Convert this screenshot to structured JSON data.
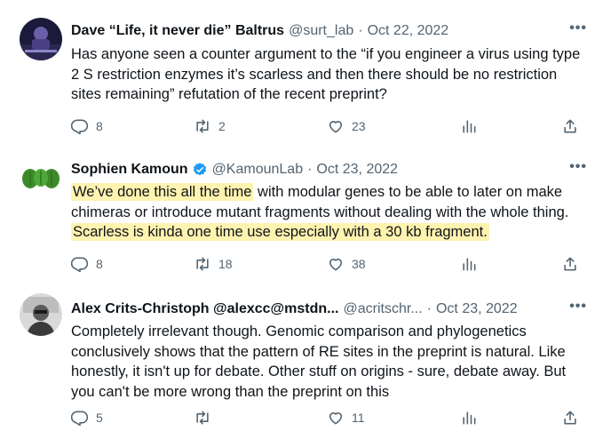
{
  "tweets": [
    {
      "name": "Dave “Life, it never die” Baltrus",
      "handle": "@surt_lab",
      "dot": "·",
      "date": "Oct 22, 2022",
      "more": "•••",
      "text": "Has anyone seen a counter argument to the “if you engineer a virus using type 2 S restriction enzymes it’s scarless and then there should be no restriction sites remaining” refutation of the recent preprint?",
      "replies": "8",
      "retweets": "2",
      "likes": "23"
    },
    {
      "name": "Sophien Kamoun",
      "handle": "@KamounLab",
      "dot": "·",
      "date": "Oct 23, 2022",
      "more": "•••",
      "text_hl1": "We’ve done this all the time",
      "text_mid": " with modular genes to be able to later on make chimeras or introduce mutant fragments without dealing with the whole thing. ",
      "text_hl2": "Scarless is kinda one time use especially with a 30 kb fragment.",
      "replies": "8",
      "retweets": "18",
      "likes": "38"
    },
    {
      "name": "Alex Crits-Christoph @alexcc@mstdn...",
      "handle": "@acritschr...",
      "dot": "·",
      "date": "Oct 23, 2022",
      "more": "•••",
      "text": "Completely irrelevant though. Genomic comparison and phylogenetics conclusively shows that the pattern of RE sites in the preprint is natural. Like honestly, it isn't up for debate. Other stuff on origins - sure, debate away. But you can't be more wrong than the preprint on this",
      "replies": "5",
      "retweets": "",
      "likes": "11"
    }
  ],
  "colors": {
    "text": "#0f1419",
    "secondary": "#536471",
    "verified": "#1d9bf0",
    "highlight": "#fff3b0"
  },
  "icons": [
    "reply-icon",
    "retweet-icon",
    "like-icon",
    "views-icon",
    "share-icon",
    "verified-badge-icon",
    "more-icon"
  ]
}
